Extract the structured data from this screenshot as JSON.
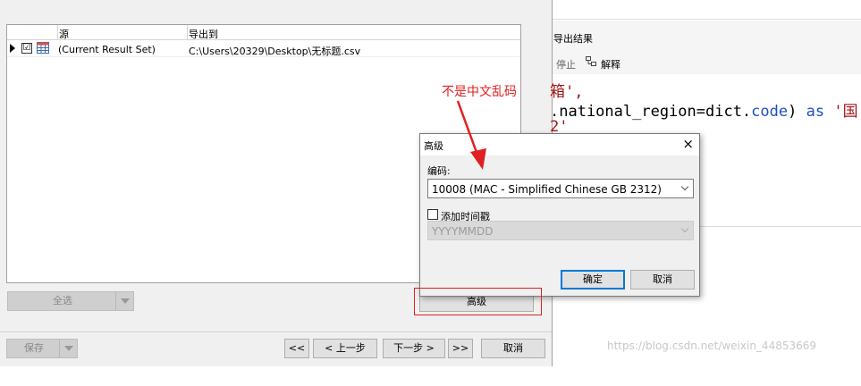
{
  "grid": {
    "headers": [
      "源",
      "导出到"
    ],
    "rows": [
      {
        "source": "(Current Result Set)",
        "target": "C:\\Users\\20329\\Desktop\\无标题.csv",
        "checked": "☑"
      }
    ]
  },
  "buttons": {
    "select_all": "全选",
    "advanced": "高级",
    "save": "保存",
    "first": "<<",
    "prev": "< 上一步",
    "next": "下一步 >",
    "last": ">>",
    "cancel": "取消"
  },
  "editor": {
    "export_result": "导出结果",
    "stop": "停止",
    "explain": "解释",
    "code_lines": {
      "line1": "箱',",
      "line2_a": ".national_region=dict.",
      "line2_b": "code",
      "line2_c": ") ",
      "line2_d": "as",
      "line2_e": " '国",
      "line3": "2'"
    }
  },
  "dialog": {
    "title": "高级",
    "close": "×",
    "encoding_label": "编码:",
    "encoding_value": "10008 (MAC - Simplified Chinese GB 2312)",
    "timestamp_label": "添加时间戳",
    "timestamp_format": "YYYYMMDD",
    "ok": "确定",
    "cancel": "取消"
  },
  "annotation": {
    "text": "不是中文乱码",
    "color": "#e02020"
  },
  "watermark": "https://blog.csdn.net/weixin_44853669"
}
